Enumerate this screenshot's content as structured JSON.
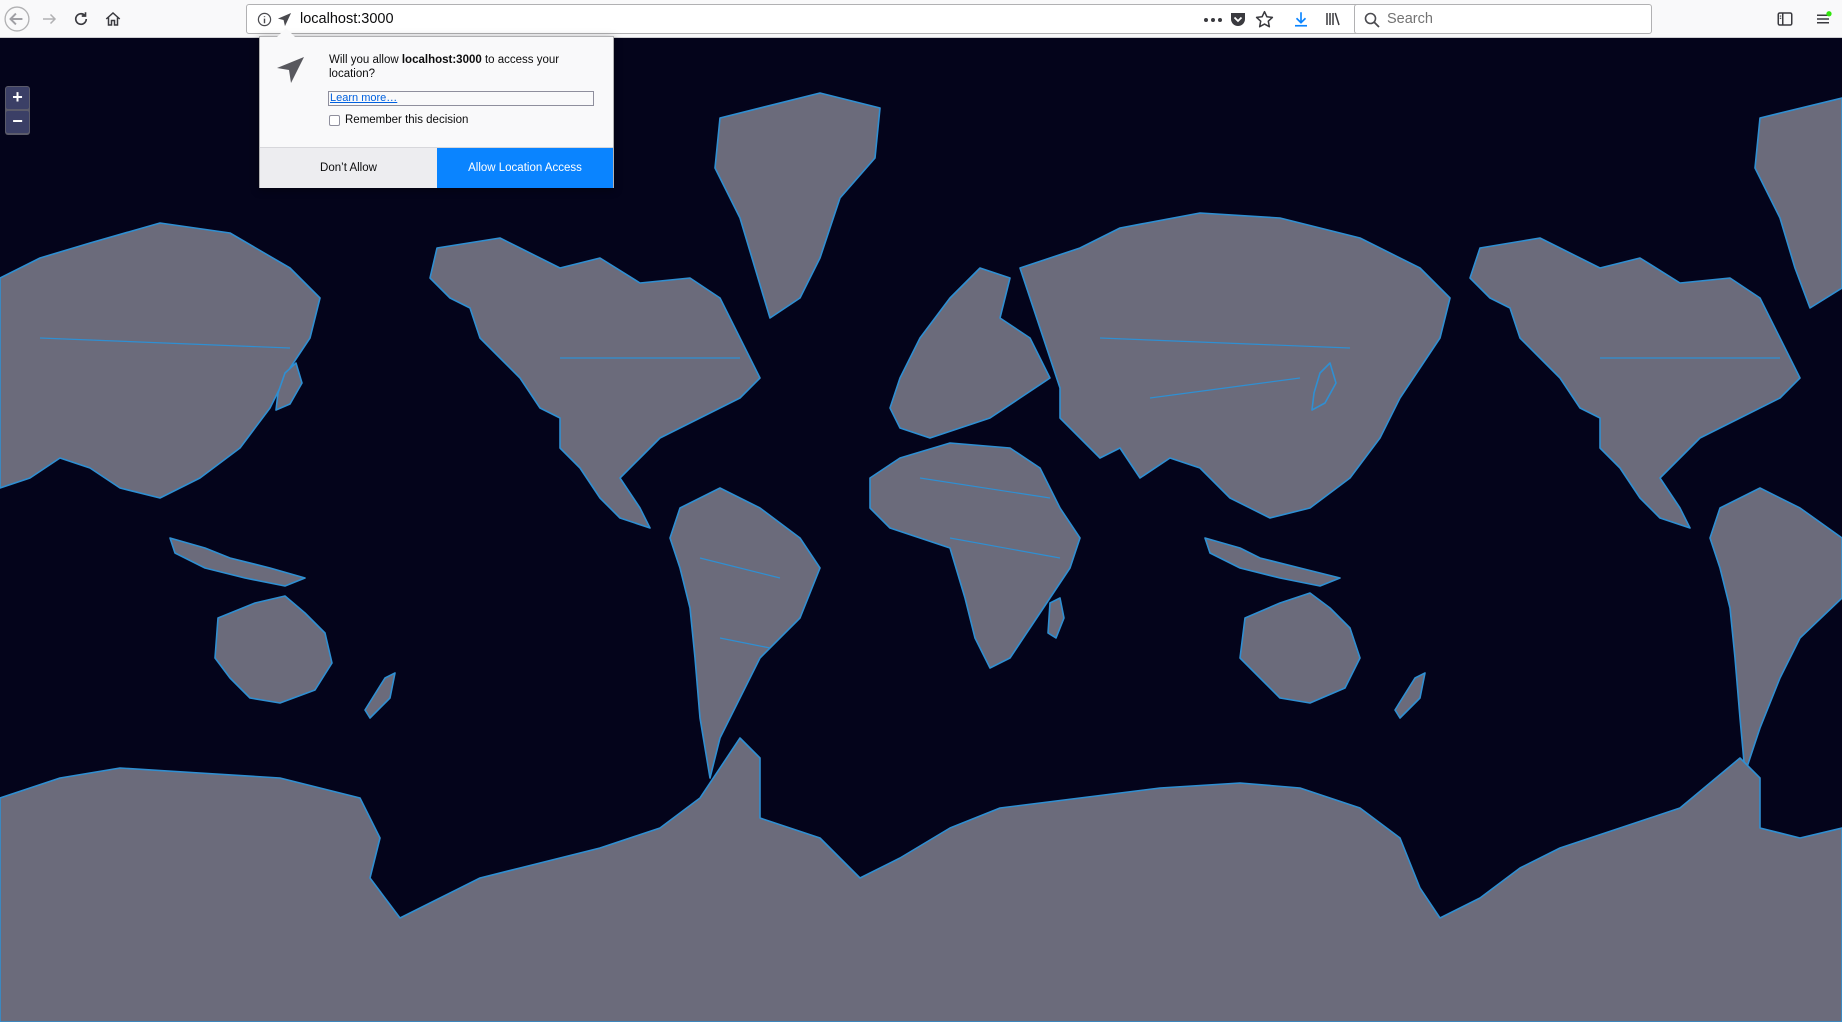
{
  "browser": {
    "url": "localhost:3000",
    "search_placeholder": "Search",
    "icons": {
      "back": "back-arrow-icon",
      "forward": "forward-arrow-icon",
      "reload": "reload-icon",
      "home": "home-icon",
      "info": "info-icon",
      "location": "location-arrow-icon",
      "more": "more-dots-icon",
      "pocket": "pocket-icon",
      "bookmark": "star-icon",
      "downloads": "download-icon",
      "library": "library-icon",
      "search": "search-icon",
      "sidebar": "sidebar-icon",
      "menu": "hamburger-menu-icon"
    }
  },
  "permission_popup": {
    "message_prefix": "Will you allow ",
    "host": "localhost:3000",
    "message_suffix": " to access your location?",
    "learn_more": "Learn more…",
    "remember_label": "Remember this decision",
    "remember_checked": false,
    "deny_label": "Don’t Allow",
    "allow_label": "Allow Location Access"
  },
  "map": {
    "zoom_in": "+",
    "zoom_out": "−",
    "colors": {
      "ocean": "#04041b",
      "land": "#6b6b7b",
      "border": "#2f8fd2"
    }
  }
}
